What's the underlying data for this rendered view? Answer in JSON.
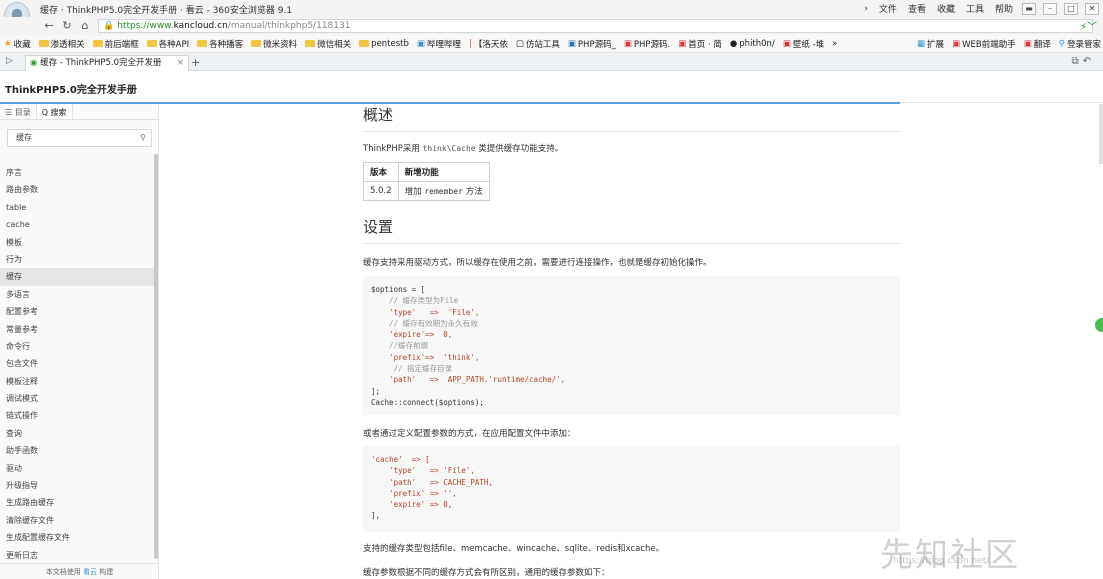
{
  "browser": {
    "window_title": "缓存 · ThinkPHP5.0完全开发手册 · 看云 - 360安全浏览器 9.1",
    "menu": [
      "文件",
      "查看",
      "收藏",
      "工具",
      "帮助"
    ],
    "url_protocol": "https://www.",
    "url_host": "kancloud.cn",
    "url_path": "/manual/thinkphp5/118131",
    "bookmarks": [
      "收藏",
      "渗透相关",
      "前后端框",
      "各种API",
      "各种播客",
      "微米资料",
      "微信相关",
      "pentestb",
      "哔哩哔哩",
      "【洛天依",
      "仿站工具",
      "PHP源码_",
      "PHP源码.",
      "首页 · 简",
      "phith0n/",
      "壁纸 -堆",
      "»"
    ],
    "bookmarks_right": [
      "扩展",
      "WEB前端助手",
      "翻译",
      "登录管家"
    ],
    "tab_title": "缓存 - ThinkPHP5.0完全开发册",
    "tab_close": "×",
    "tab_add": "+"
  },
  "page": {
    "title": "ThinkPHP5.0完全开发手册"
  },
  "sidebar": {
    "tabs": [
      "☰ 目录",
      "Q 搜索"
    ],
    "search_value": "缓存",
    "items": [
      "序言",
      "路由参数",
      "table",
      "cache",
      "模板",
      "行为",
      "缓存",
      "多语言",
      "配置参考",
      "常量参考",
      "命令行",
      "包含文件",
      "模板注释",
      "调试模式",
      "链式操作",
      "查询",
      "助手函数",
      "驱动",
      "升级指导",
      "生成路由缓存",
      "清除缓存文件",
      "生成配置缓存文件",
      "更新日志"
    ],
    "active_index": 6,
    "footer_prefix": "本文档使用",
    "footer_link": "看云",
    "footer_suffix": "构建"
  },
  "content": {
    "h_overview": "概述",
    "intro_prefix": "ThinkPHP采用",
    "intro_code": "think\\Cache",
    "intro_suffix": "类提供缓存功能支持。",
    "table_headers": [
      "版本",
      "新增功能"
    ],
    "table_row": {
      "version": "5.0.2",
      "feature_prefix": "增加",
      "feature_code": "remember",
      "feature_suffix": "方法"
    },
    "h_settings": "设置",
    "settings_text": "缓存支持采用驱动方式，所以缓存在使用之前，需要进行连接操作，也就是缓存初始化操作。",
    "code1": [
      "$options = [",
      "    // 缓存类型为File",
      "    'type'   =>  'File',",
      "    // 缓存有效期为永久有效",
      "    'expire'=>  0,",
      "    //缓存前缀",
      "    'prefix'=>  'think',",
      "     // 指定缓存目录",
      "    'path'   =>  APP_PATH.'runtime/cache/',",
      "];",
      "Cache::connect($options);"
    ],
    "config_text": "或者通过定义配置参数的方式，在应用配置文件中添加：",
    "code2": [
      "'cache'  => [",
      "    'type'   => 'File',",
      "    'path'   => CACHE_PATH,",
      "    'prefix' => '',",
      "    'expire' => 0,",
      "],"
    ],
    "types_text": "支持的缓存类型包括file、memcache、wincache、sqlite、redis和xcache。",
    "params_text": "缓存参数根据不同的缓存方式会有所区别，通用的缓存参数如下："
  },
  "watermark": {
    "main": "先知社区",
    "url": "https://blog.csdn.net/..."
  }
}
